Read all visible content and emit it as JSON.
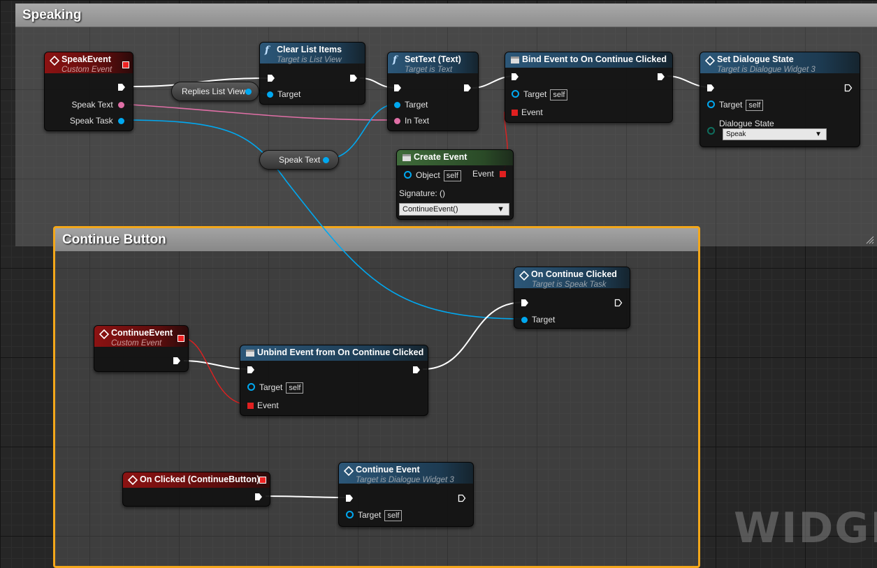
{
  "comments": {
    "speaking": "Speaking",
    "continue": "Continue Button"
  },
  "nodes": {
    "speak_event": {
      "title": "SpeakEvent",
      "subtitle": "Custom Event",
      "pins": {
        "speak_text": "Speak Text",
        "speak_task": "Speak Task"
      }
    },
    "clear_list": {
      "title": "Clear List Items",
      "subtitle": "Target is List View",
      "pins": {
        "target": "Target"
      }
    },
    "replies_list_view": "Replies List View",
    "set_text": {
      "title": "SetText (Text)",
      "subtitle": "Target is Text",
      "pins": {
        "target": "Target",
        "in_text": "In Text"
      }
    },
    "bind_event": {
      "title": "Bind Event to On Continue Clicked",
      "pins": {
        "target": "Target",
        "target_default": "self",
        "event": "Event"
      }
    },
    "set_dialogue": {
      "title": "Set Dialogue State",
      "subtitle": "Target is Dialogue Widget 3",
      "pins": {
        "target": "Target",
        "target_default": "self",
        "state": "Dialogue State",
        "state_value": "Speak"
      }
    },
    "speak_text_var": "Speak Text",
    "create_event": {
      "title": "Create Event",
      "pins": {
        "object": "Object",
        "object_default": "self",
        "event": "Event",
        "signature": "Signature: ()",
        "function": "ContinueEvent()"
      }
    },
    "on_continue": {
      "title": "On Continue Clicked",
      "subtitle": "Target is Speak Task",
      "pins": {
        "target": "Target"
      }
    },
    "continue_event": {
      "title": "ContinueEvent",
      "subtitle": "Custom Event"
    },
    "unbind_event": {
      "title": "Unbind Event from On Continue Clicked",
      "pins": {
        "target": "Target",
        "target_default": "self",
        "event": "Event"
      }
    },
    "on_clicked": {
      "title": "On Clicked (ContinueButton)"
    },
    "continue_call": {
      "title": "Continue Event",
      "subtitle": "Target is Dialogue Widget 3",
      "pins": {
        "target": "Target",
        "target_default": "self"
      }
    }
  },
  "watermark": "WIDGET",
  "colors": {
    "event_header": "#8c1212",
    "function_header": "#2c5778",
    "create_event_header": "#3f6b3a",
    "object_pin": "#00a8f0",
    "text_pin": "#e06fa6",
    "delegate_pin": "#e02020",
    "exec_wire": "#ffffff",
    "selection": "#f3a71a"
  },
  "icons": {
    "event": "event-diamond-icon",
    "function": "function-f-icon",
    "delegate": "delegate-square-icon",
    "bind": "bind-event-icon",
    "dropdown": "chevron-down-icon"
  }
}
